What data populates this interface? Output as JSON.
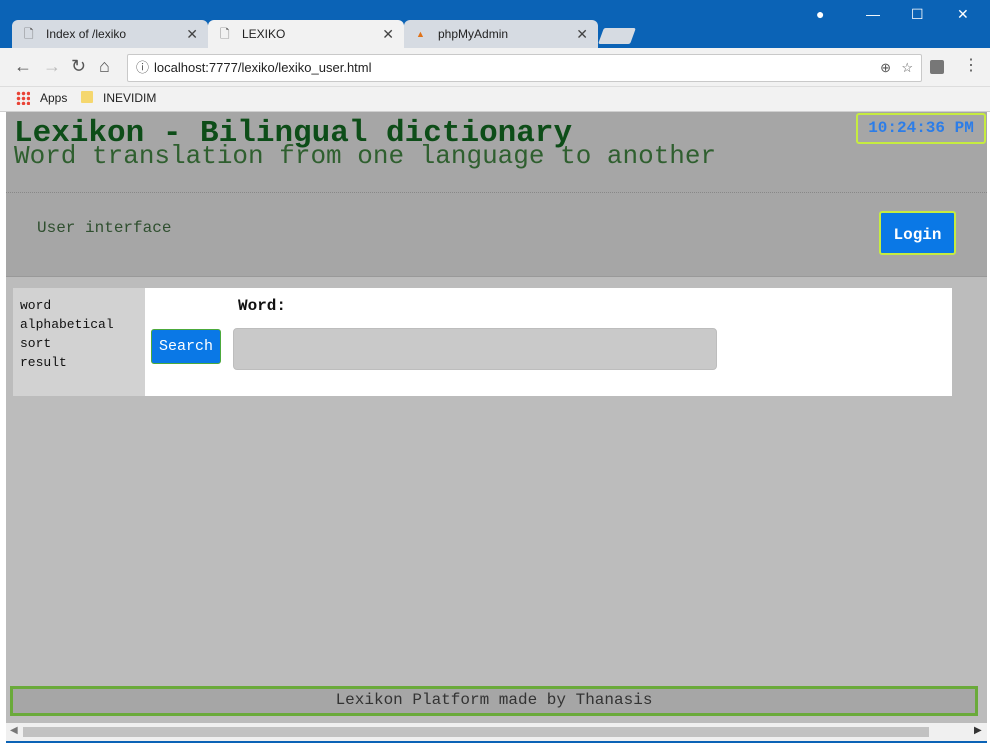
{
  "browser": {
    "tabs": [
      {
        "label": "Index of /lexiko",
        "close": "✕"
      },
      {
        "label": "LEXIKO",
        "close": "✕"
      },
      {
        "label": "phpMyAdmin",
        "close": "✕"
      }
    ],
    "url": "localhost:7777/lexiko/lexiko_user.html",
    "bookmarks": [
      {
        "label": "Apps"
      },
      {
        "label": "INEVIDIM"
      }
    ]
  },
  "page": {
    "title": "Lexikon - Bilingual dictionary",
    "subtitle": "Word translation from one language to another",
    "clock": "10:24:36 PM",
    "section_label": "User interface",
    "login_label": "Login",
    "side_menu": [
      "word",
      "alphabetical",
      "sort",
      "result"
    ],
    "search_label": "Search",
    "word_label": "Word:",
    "word_value": "",
    "footer": "Lexikon Platform made by Thanasis"
  },
  "colors": {
    "title_green": "#0d4d18",
    "button_blue": "#0a78e6",
    "accent_lime": "#c6ec40",
    "footer_border": "#6aaa3a",
    "page_bg": "#bcbcbc"
  }
}
